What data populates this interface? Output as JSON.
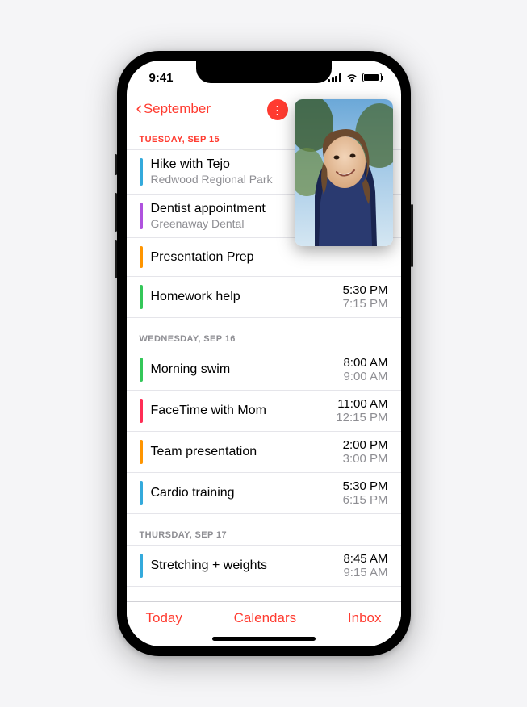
{
  "status": {
    "time": "9:41"
  },
  "nav": {
    "back_label": "September"
  },
  "sections": [
    {
      "header": "TUESDAY, SEP 15",
      "header_class": "first",
      "events": [
        {
          "title": "Hike with Tejo",
          "subtitle": "Redwood Regional Park",
          "start": "",
          "end": "",
          "color": "#34aadc"
        },
        {
          "title": "Dentist appointment",
          "subtitle": "Greenaway Dental",
          "start": "",
          "end": "",
          "color": "#af52de"
        },
        {
          "title": "Presentation Prep",
          "subtitle": "",
          "start": "",
          "end": "",
          "color": "#ff9500"
        },
        {
          "title": "Homework help",
          "subtitle": "",
          "start": "5:30 PM",
          "end": "7:15 PM",
          "color": "#34c759"
        }
      ]
    },
    {
      "header": "WEDNESDAY, SEP 16",
      "header_class": "rest",
      "events": [
        {
          "title": "Morning swim",
          "subtitle": "",
          "start": "8:00 AM",
          "end": "9:00 AM",
          "color": "#34c759"
        },
        {
          "title": "FaceTime with Mom",
          "subtitle": "",
          "start": "11:00 AM",
          "end": "12:15 PM",
          "color": "#ff2d55"
        },
        {
          "title": "Team presentation",
          "subtitle": "",
          "start": "2:00 PM",
          "end": "3:00 PM",
          "color": "#ff9500"
        },
        {
          "title": "Cardio training",
          "subtitle": "",
          "start": "5:30 PM",
          "end": "6:15 PM",
          "color": "#34aadc"
        }
      ]
    },
    {
      "header": "THURSDAY, SEP 17",
      "header_class": "rest",
      "events": [
        {
          "title": "Stretching + weights",
          "subtitle": "",
          "start": "8:45 AM",
          "end": "9:15 AM",
          "color": "#34aadc"
        }
      ]
    }
  ],
  "toolbar": {
    "today": "Today",
    "calendars": "Calendars",
    "inbox": "Inbox"
  }
}
